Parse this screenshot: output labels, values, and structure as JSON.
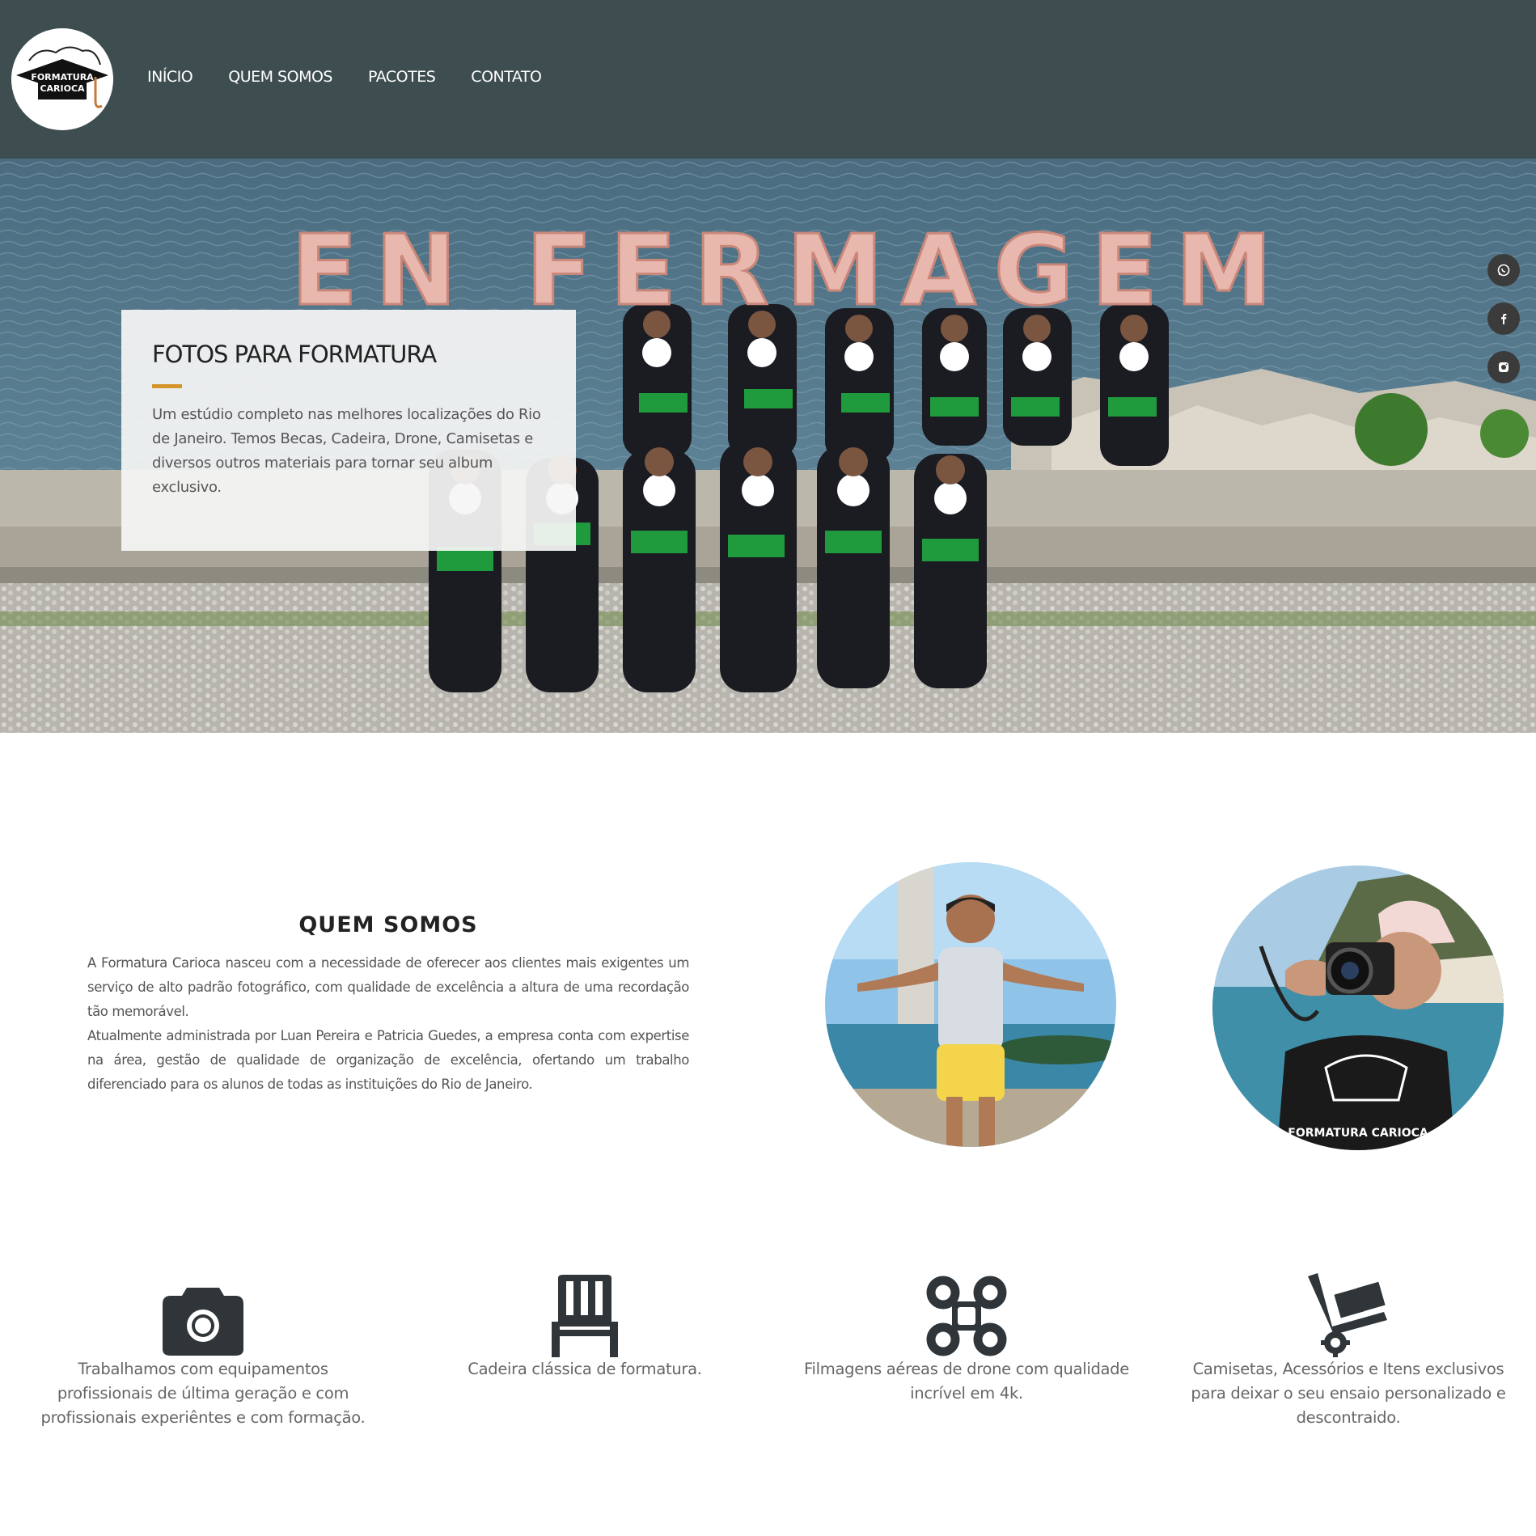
{
  "header": {
    "logo_text_line1": "FORMATURA",
    "logo_text_line2": "CARIOCA",
    "nav": [
      "INÍCIO",
      "QUEM SOMOS",
      "PACOTES",
      "CONTATO"
    ]
  },
  "hero": {
    "balloon_text": "EN FERMAGEM",
    "card_title": "FOTOS PARA FORMATURA",
    "card_text": "Um estúdio completo nas melhores localizações do Rio de Janeiro. Temos Becas, Cadeira, Drone, Camisetas e diversos outros materiais para tornar seu album exclusivo."
  },
  "social": [
    {
      "name": "whatsapp",
      "icon": "whatsapp-icon"
    },
    {
      "name": "facebook",
      "icon": "facebook-icon"
    },
    {
      "name": "instagram",
      "icon": "instagram-icon"
    }
  ],
  "about": {
    "title": "QUEM SOMOS",
    "paragraph1": "A Formatura Carioca nasceu com a necessidade de oferecer aos clientes mais exigentes um serviço de alto padrão fotográfico, com qualidade de excelência a altura de uma recordação tão memorável.",
    "paragraph2": "Atualmente administrada por Luan Pereira e Patricia Guedes, a empresa conta com expertise na área, gestão de qualidade de organização de excelência, ofertando um trabalho diferenciado para os alunos de todas as instituições do Rio de Janeiro.",
    "photo2_shirt_text": "FORMATURA CARIOCA"
  },
  "features": [
    {
      "icon": "camera-icon",
      "text": "Trabalhamos com equipamentos profissionais de última geração e com profissionais experiêntes e com formação."
    },
    {
      "icon": "chair-icon",
      "text": "Cadeira clássica de formatura."
    },
    {
      "icon": "drone-icon",
      "text": "Filmagens aéreas de drone com qualidade incrível em 4k."
    },
    {
      "icon": "hand-truck-icon",
      "text": "Camisetas, Acessórios e Itens exclusivos para deixar o seu ensaio personalizado e descontraido."
    }
  ],
  "colors": {
    "header_bg": "#3e4d4f",
    "accent": "#d4962a",
    "icon_dark": "#2f3538"
  }
}
